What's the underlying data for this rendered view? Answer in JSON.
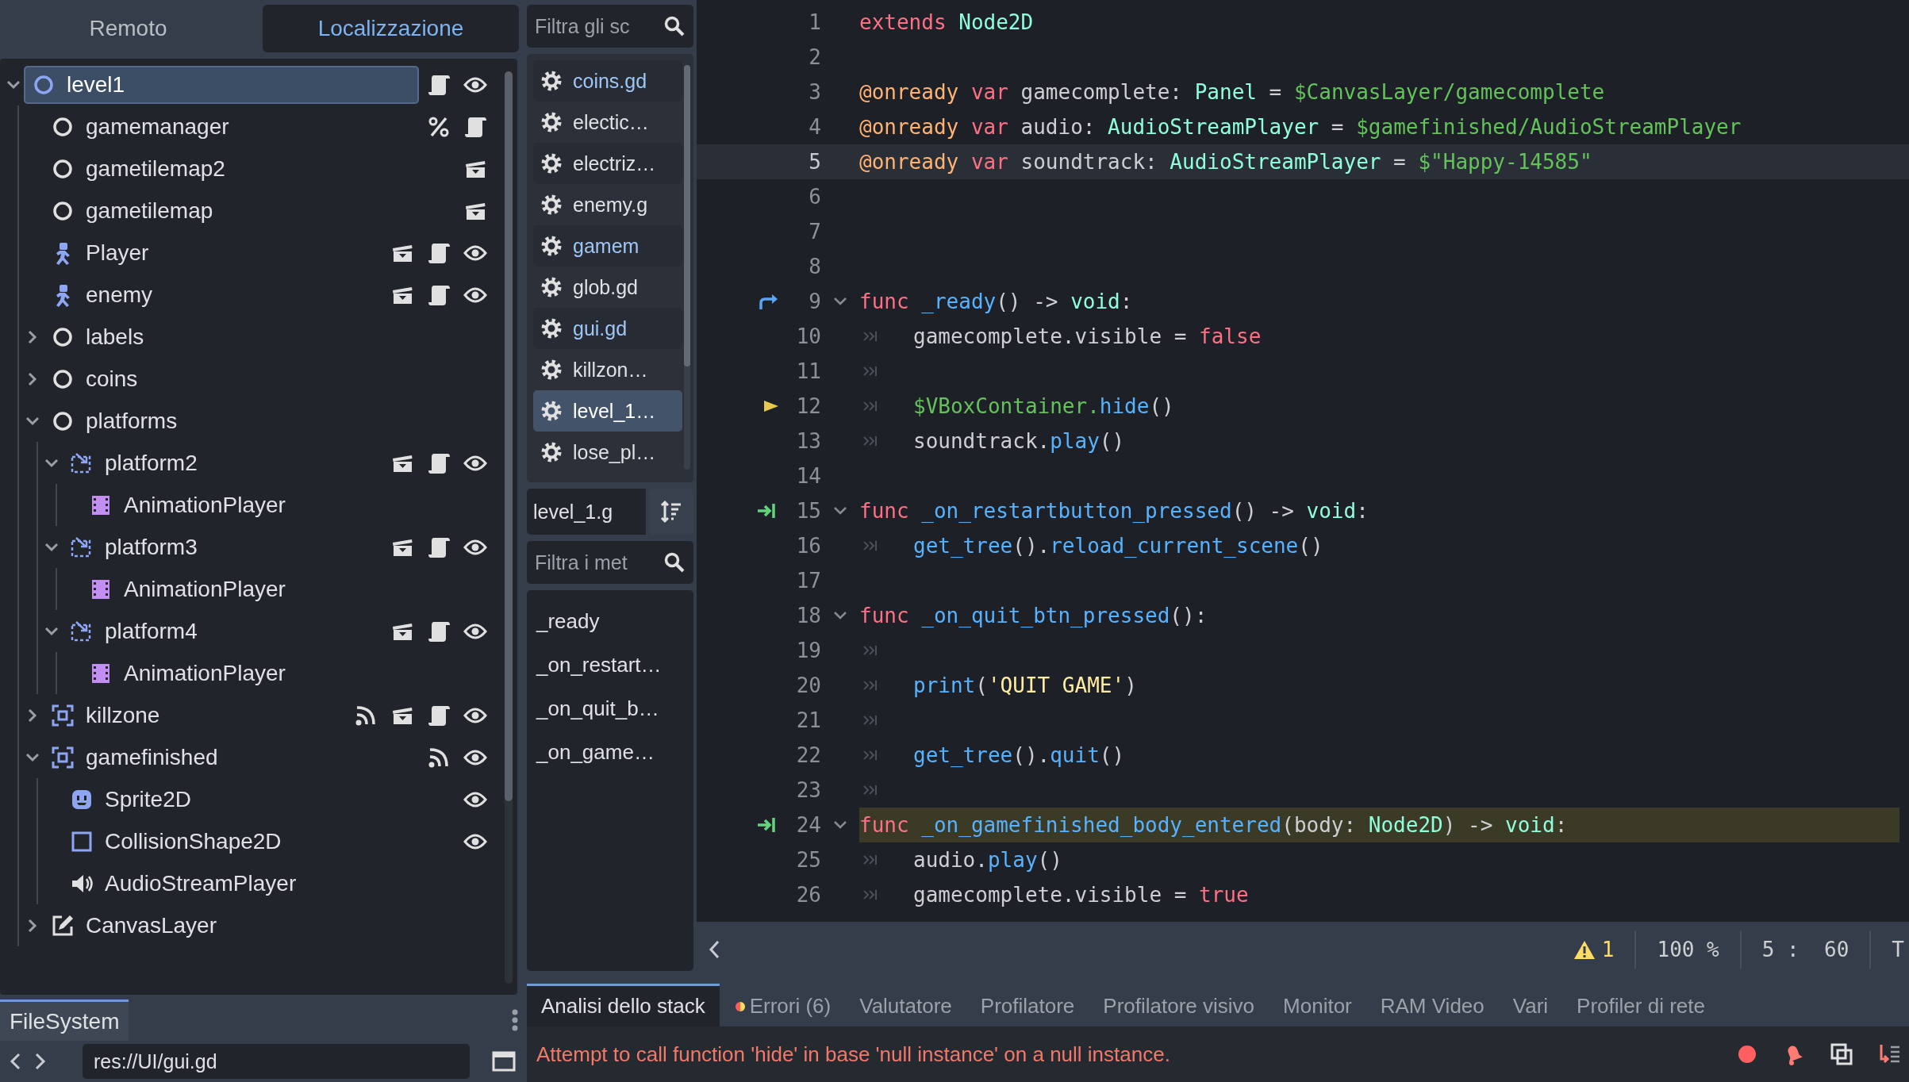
{
  "scene_dock": {
    "tabs": [
      {
        "label": "Remoto",
        "selected": false
      },
      {
        "label": "Localizzazione",
        "selected": true
      }
    ],
    "tree": [
      {
        "label": "level1",
        "kind": "root",
        "selected": true,
        "expanded": true,
        "badges": [
          {
            "kind": "script"
          },
          {
            "kind": "eye"
          }
        ],
        "children": [
          {
            "label": "gamemanager",
            "kind": "node",
            "selected": false,
            "badges": [
              {
                "kind": "unique"
              },
              {
                "kind": "script"
              }
            ]
          },
          {
            "label": "gametilemap2",
            "kind": "node",
            "selected": false,
            "badges": [
              {
                "kind": "scene"
              }
            ]
          },
          {
            "label": "gametilemap",
            "kind": "node",
            "selected": false,
            "badges": [
              {
                "kind": "scene"
              }
            ]
          },
          {
            "label": "Player",
            "kind": "character",
            "selected": false,
            "badges": [
              {
                "kind": "scene"
              },
              {
                "kind": "script"
              },
              {
                "kind": "eye"
              }
            ]
          },
          {
            "label": "enemy",
            "kind": "character",
            "selected": false,
            "badges": [
              {
                "kind": "scene"
              },
              {
                "kind": "script"
              },
              {
                "kind": "eye"
              }
            ]
          },
          {
            "label": "labels",
            "kind": "node",
            "selected": false,
            "expanded": false
          },
          {
            "label": "coins",
            "kind": "node",
            "selected": false,
            "expanded": false
          },
          {
            "label": "platforms",
            "kind": "node",
            "selected": false,
            "expanded": true,
            "children": [
              {
                "label": "platform2",
                "kind": "path",
                "selected": false,
                "expanded": true,
                "badges": [
                  {
                    "kind": "scene"
                  },
                  {
                    "kind": "script"
                  },
                  {
                    "kind": "eye"
                  }
                ],
                "children": [
                  {
                    "label": "AnimationPlayer",
                    "kind": "anim",
                    "selected": false
                  }
                ]
              },
              {
                "label": "platform3",
                "kind": "path",
                "selected": false,
                "expanded": true,
                "badges": [
                  {
                    "kind": "scene"
                  },
                  {
                    "kind": "script"
                  },
                  {
                    "kind": "eye"
                  }
                ],
                "children": [
                  {
                    "label": "AnimationPlayer",
                    "kind": "anim",
                    "selected": false
                  }
                ]
              },
              {
                "label": "platform4",
                "kind": "path",
                "selected": false,
                "expanded": true,
                "badges": [
                  {
                    "kind": "scene"
                  },
                  {
                    "kind": "script"
                  },
                  {
                    "kind": "eye"
                  }
                ],
                "children": [
                  {
                    "label": "AnimationPlayer",
                    "kind": "anim",
                    "selected": false
                  }
                ]
              }
            ]
          },
          {
            "label": "killzone",
            "kind": "area",
            "selected": false,
            "expanded": false,
            "badges": [
              {
                "kind": "signal"
              },
              {
                "kind": "scene"
              },
              {
                "kind": "script"
              },
              {
                "kind": "eye"
              }
            ]
          },
          {
            "label": "gamefinished",
            "kind": "area",
            "selected": false,
            "expanded": true,
            "badges": [
              {
                "kind": "signal"
              },
              {
                "kind": "eye"
              }
            ],
            "children": [
              {
                "label": "Sprite2D",
                "kind": "sprite",
                "selected": false,
                "badges": [
                  {
                    "kind": "eye"
                  }
                ]
              },
              {
                "label": "CollisionShape2D",
                "kind": "collision",
                "selected": false,
                "badges": [
                  {
                    "kind": "eye"
                  }
                ]
              },
              {
                "label": "AudioStreamPlayer",
                "kind": "audio",
                "selected": false
              }
            ]
          },
          {
            "label": "CanvasLayer",
            "kind": "canvas",
            "selected": false,
            "expanded": false
          }
        ]
      }
    ]
  },
  "filesystem_dock": {
    "tabs": [
      {
        "label": "FileSystem",
        "selected": true
      }
    ],
    "path": "res://UI/gui.gd"
  },
  "script_panel": {
    "filter": {
      "placeholder": "Filtra gli sc"
    },
    "scripts": [
      {
        "label": "coins.gd",
        "open": true,
        "selected": false
      },
      {
        "label": "electic…",
        "open": false,
        "selected": false
      },
      {
        "label": "electriz…",
        "open": false,
        "selected": false
      },
      {
        "label": "enemy.g",
        "open": false,
        "selected": false
      },
      {
        "label": "gamem",
        "open": true,
        "selected": false
      },
      {
        "label": "glob.gd",
        "open": false,
        "selected": false
      },
      {
        "label": "gui.gd",
        "open": true,
        "selected": false
      },
      {
        "label": "killzon…",
        "open": false,
        "selected": false
      },
      {
        "label": "level_1…",
        "open": false,
        "selected": true
      },
      {
        "label": "lose_pl…",
        "open": false,
        "selected": false
      }
    ],
    "current_script": "level_1.g",
    "method_filter": {
      "placeholder": "Filtra i met"
    },
    "methods": [
      "_ready",
      "_on_restart…",
      "_on_quit_b…",
      "_on_game…"
    ]
  },
  "editor": {
    "lines": [
      {
        "number": "1",
        "fold": false,
        "indented": false,
        "current_line": false,
        "executing": false,
        "tokens": [
          {
            "kind": "kw",
            "text": "extends "
          },
          {
            "kind": "type",
            "text": "Node2D"
          }
        ]
      },
      {
        "number": "2",
        "fold": false,
        "indented": false,
        "current_line": false,
        "executing": false
      },
      {
        "number": "3",
        "fold": false,
        "indented": false,
        "current_line": false,
        "executing": false,
        "tokens": [
          {
            "kind": "ann",
            "text": "@onready "
          },
          {
            "kind": "kw",
            "text": "var "
          },
          {
            "kind": "txt",
            "text": "gamecomplete: "
          },
          {
            "kind": "type",
            "text": "Panel"
          },
          {
            "kind": "txt",
            "text": " = "
          },
          {
            "kind": "path",
            "text": "$CanvasLayer/gamecomplete"
          }
        ]
      },
      {
        "number": "4",
        "fold": false,
        "indented": false,
        "current_line": false,
        "executing": false,
        "tokens": [
          {
            "kind": "ann",
            "text": "@onready "
          },
          {
            "kind": "kw",
            "text": "var "
          },
          {
            "kind": "txt",
            "text": "audio: "
          },
          {
            "kind": "type",
            "text": "AudioStreamPlayer"
          },
          {
            "kind": "txt",
            "text": " = "
          },
          {
            "kind": "path",
            "text": "$gamefinished/AudioStreamPlayer"
          }
        ]
      },
      {
        "number": "5",
        "fold": false,
        "indented": false,
        "current_line": true,
        "executing": false,
        "tokens": [
          {
            "kind": "ann",
            "text": "@onready "
          },
          {
            "kind": "kw",
            "text": "var "
          },
          {
            "kind": "txt",
            "text": "soundtrack: "
          },
          {
            "kind": "type",
            "text": "AudioStreamPlayer"
          },
          {
            "kind": "txt",
            "text": " = "
          },
          {
            "kind": "path",
            "text": "$\"Happy-14585\""
          }
        ]
      },
      {
        "number": "6",
        "fold": false,
        "indented": false,
        "current_line": false,
        "executing": false
      },
      {
        "number": "7",
        "fold": false,
        "indented": false,
        "current_line": false,
        "executing": false
      },
      {
        "number": "8",
        "fold": false,
        "indented": false,
        "current_line": false,
        "executing": false
      },
      {
        "number": "9",
        "marker": {
          "kind": "override"
        },
        "fold": true,
        "indented": false,
        "current_line": false,
        "executing": false,
        "tokens": [
          {
            "kind": "kw",
            "text": "func "
          },
          {
            "kind": "fn",
            "text": "_ready"
          },
          {
            "kind": "txt",
            "text": "() -> "
          },
          {
            "kind": "type",
            "text": "void"
          },
          {
            "kind": "txt",
            "text": ":"
          }
        ]
      },
      {
        "number": "10",
        "fold": false,
        "indented": true,
        "current_line": false,
        "executing": false,
        "tokens": [
          {
            "kind": "txt",
            "text": "gamecomplete.visible = "
          },
          {
            "kind": "kw",
            "text": "false"
          }
        ]
      },
      {
        "number": "11",
        "fold": false,
        "indented": true,
        "current_line": false,
        "executing": false
      },
      {
        "number": "12",
        "marker": {
          "kind": "exec"
        },
        "fold": false,
        "indented": true,
        "current_line": false,
        "executing": false,
        "tokens": [
          {
            "kind": "path",
            "text": "$VBoxContainer."
          },
          {
            "kind": "fn",
            "text": "hide"
          },
          {
            "kind": "txt",
            "text": "()"
          }
        ]
      },
      {
        "number": "13",
        "fold": false,
        "indented": true,
        "current_line": false,
        "executing": false,
        "tokens": [
          {
            "kind": "txt",
            "text": "soundtrack."
          },
          {
            "kind": "fn",
            "text": "play"
          },
          {
            "kind": "txt",
            "text": "()"
          }
        ]
      },
      {
        "number": "14",
        "fold": false,
        "indented": false,
        "current_line": false,
        "executing": false
      },
      {
        "number": "15",
        "marker": {
          "kind": "signal"
        },
        "fold": true,
        "indented": false,
        "current_line": false,
        "executing": false,
        "tokens": [
          {
            "kind": "kw",
            "text": "func "
          },
          {
            "kind": "fn",
            "text": "_on_restartbutton_pressed"
          },
          {
            "kind": "txt",
            "text": "() -> "
          },
          {
            "kind": "type",
            "text": "void"
          },
          {
            "kind": "txt",
            "text": ":"
          }
        ]
      },
      {
        "number": "16",
        "fold": false,
        "indented": true,
        "current_line": false,
        "executing": false,
        "tokens": [
          {
            "kind": "fn",
            "text": "get_tree"
          },
          {
            "kind": "txt",
            "text": "()."
          },
          {
            "kind": "fn",
            "text": "reload_current_scene"
          },
          {
            "kind": "txt",
            "text": "()"
          }
        ]
      },
      {
        "number": "17",
        "fold": false,
        "indented": false,
        "current_line": false,
        "executing": false
      },
      {
        "number": "18",
        "fold": true,
        "indented": false,
        "current_line": false,
        "executing": false,
        "tokens": [
          {
            "kind": "kw",
            "text": "func "
          },
          {
            "kind": "fn",
            "text": "_on_quit_btn_pressed"
          },
          {
            "kind": "txt",
            "text": "():"
          }
        ]
      },
      {
        "number": "19",
        "fold": false,
        "indented": true,
        "current_line": false,
        "executing": false
      },
      {
        "number": "20",
        "fold": false,
        "indented": true,
        "current_line": false,
        "executing": false,
        "tokens": [
          {
            "kind": "fn",
            "text": "print"
          },
          {
            "kind": "txt",
            "text": "("
          },
          {
            "kind": "str",
            "text": "'QUIT GAME'"
          },
          {
            "kind": "txt",
            "text": ")"
          }
        ]
      },
      {
        "number": "21",
        "fold": false,
        "indented": true,
        "current_line": false,
        "executing": false
      },
      {
        "number": "22",
        "fold": false,
        "indented": true,
        "current_line": false,
        "executing": false,
        "tokens": [
          {
            "kind": "fn",
            "text": "get_tree"
          },
          {
            "kind": "txt",
            "text": "()."
          },
          {
            "kind": "fn",
            "text": "quit"
          },
          {
            "kind": "txt",
            "text": "()"
          }
        ]
      },
      {
        "number": "23",
        "fold": false,
        "indented": true,
        "current_line": false,
        "executing": false
      },
      {
        "number": "24",
        "marker": {
          "kind": "signal"
        },
        "fold": true,
        "indented": false,
        "current_line": false,
        "executing": true,
        "tokens": [
          {
            "kind": "kw",
            "text": "func "
          },
          {
            "kind": "fn",
            "text": "_on_gamefinished_body_entered"
          },
          {
            "kind": "txt",
            "text": "(body: "
          },
          {
            "kind": "type",
            "text": "Node2D"
          },
          {
            "kind": "txt",
            "text": ") -> "
          },
          {
            "kind": "type",
            "text": "void"
          },
          {
            "kind": "txt",
            "text": ":"
          }
        ]
      },
      {
        "number": "25",
        "fold": false,
        "indented": true,
        "current_line": false,
        "executing": false,
        "tokens": [
          {
            "kind": "txt",
            "text": "audio."
          },
          {
            "kind": "fn",
            "text": "play"
          },
          {
            "kind": "txt",
            "text": "()"
          }
        ]
      },
      {
        "number": "26",
        "fold": false,
        "indented": true,
        "current_line": false,
        "executing": false,
        "tokens": [
          {
            "kind": "txt",
            "text": "gamecomplete.visible = "
          },
          {
            "kind": "kw",
            "text": "true"
          }
        ]
      }
    ]
  },
  "status_bar": {
    "warnings": "1",
    "zoom": "100 %",
    "cursor": "5 :  60",
    "indent_mode": "T"
  },
  "bottom_panel": {
    "tabs": [
      {
        "label": "Analisi dello stack",
        "selected": true,
        "kind": "plain"
      },
      {
        "label": "Errori (6)",
        "selected": false,
        "kind": "errors"
      },
      {
        "label": "Valutatore",
        "selected": false,
        "kind": "plain"
      },
      {
        "label": "Profilatore",
        "selected": false,
        "kind": "plain"
      },
      {
        "label": "Profilatore visivo",
        "selected": false,
        "kind": "plain"
      },
      {
        "label": "Monitor",
        "selected": false,
        "kind": "plain"
      },
      {
        "label": "RAM Video",
        "selected": false,
        "kind": "plain"
      },
      {
        "label": "Vari",
        "selected": false,
        "kind": "plain"
      },
      {
        "label": "Profiler di rete",
        "selected": false,
        "kind": "plain"
      }
    ],
    "message": "Attempt to call function 'hide' in base 'null instance' on a null instance."
  }
}
